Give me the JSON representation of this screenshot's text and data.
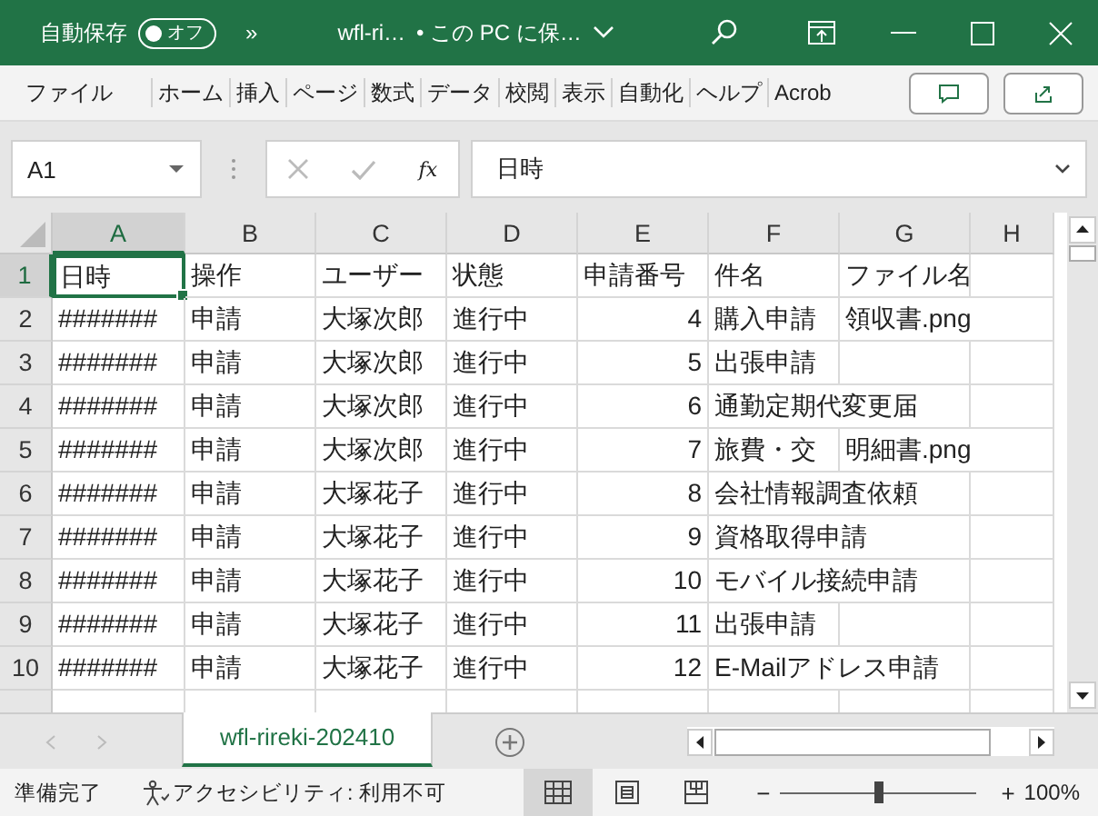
{
  "title_bar": {
    "autosave_label": "自動保存",
    "autosave_toggle": {
      "label": "オフ",
      "on": false
    },
    "more": "»",
    "file_name": "wfl-ri…",
    "save_status": "• この PC に保…"
  },
  "ribbon_tabs": [
    {
      "label": "ファイル",
      "selected": false
    },
    {
      "label": "ホーム",
      "selected": false
    },
    {
      "label": "挿入",
      "selected": false
    },
    {
      "label": "ページ",
      "selected": false
    },
    {
      "label": "数式",
      "selected": false
    },
    {
      "label": "データ",
      "selected": false
    },
    {
      "label": "校閲",
      "selected": false
    },
    {
      "label": "表示",
      "selected": false
    },
    {
      "label": "自動化",
      "selected": false
    },
    {
      "label": "ヘルプ",
      "selected": false
    },
    {
      "label": "Acrob",
      "selected": false
    }
  ],
  "formula_bar": {
    "name_box": "A1",
    "fx": "fx",
    "value": "日時"
  },
  "sheet": {
    "columns": [
      {
        "label": "A",
        "selected": true
      },
      {
        "label": "B",
        "selected": false
      },
      {
        "label": "C",
        "selected": false
      },
      {
        "label": "D",
        "selected": false
      },
      {
        "label": "E",
        "selected": false
      },
      {
        "label": "F",
        "selected": false
      },
      {
        "label": "G",
        "selected": false
      },
      {
        "label": "H",
        "selected": false
      }
    ],
    "rows": [
      {
        "label": "1",
        "selected": true,
        "cells": [
          "日時",
          "操作",
          "ユーザー",
          "状態",
          "申請番号",
          "件名",
          "ファイル名"
        ]
      },
      {
        "label": "2",
        "selected": false,
        "cells": [
          "#######",
          "申請",
          "大塚次郎",
          "進行中",
          "4",
          "購入申請",
          "領収書.png"
        ]
      },
      {
        "label": "3",
        "selected": false,
        "cells": [
          "#######",
          "申請",
          "大塚次郎",
          "進行中",
          "5",
          "出張申請",
          null
        ]
      },
      {
        "label": "4",
        "selected": false,
        "cells": [
          "#######",
          "申請",
          "大塚次郎",
          "進行中",
          "6",
          "通勤定期代変更届",
          null
        ]
      },
      {
        "label": "5",
        "selected": false,
        "cells": [
          "#######",
          "申請",
          "大塚次郎",
          "進行中",
          "7",
          "旅費・交",
          "明細書.png"
        ]
      },
      {
        "label": "6",
        "selected": false,
        "cells": [
          "#######",
          "申請",
          "大塚花子",
          "進行中",
          "8",
          "会社情報調査依頼",
          null
        ]
      },
      {
        "label": "7",
        "selected": false,
        "cells": [
          "#######",
          "申請",
          "大塚花子",
          "進行中",
          "9",
          "資格取得申請",
          null
        ]
      },
      {
        "label": "8",
        "selected": false,
        "cells": [
          "#######",
          "申請",
          "大塚花子",
          "進行中",
          "10",
          "モバイル接続申請",
          null
        ]
      },
      {
        "label": "9",
        "selected": false,
        "cells": [
          "#######",
          "申請",
          "大塚花子",
          "進行中",
          "11",
          "出張申請",
          null
        ]
      },
      {
        "label": "10",
        "selected": false,
        "cells": [
          "#######",
          "申請",
          "大塚花子",
          "進行中",
          "12",
          "E-Mailアドレス申請",
          null
        ]
      }
    ]
  },
  "sheet_tabs": [
    {
      "label": "wfl-rireki-202410",
      "selected": true
    }
  ],
  "status_bar": {
    "ready": "準備完了",
    "accessibility": "アクセシビリティ: 利用不可",
    "zoom_minus": "−",
    "zoom_plus": "+",
    "zoom": {
      "level": 0.5
    },
    "zoom_percent": "100%"
  }
}
